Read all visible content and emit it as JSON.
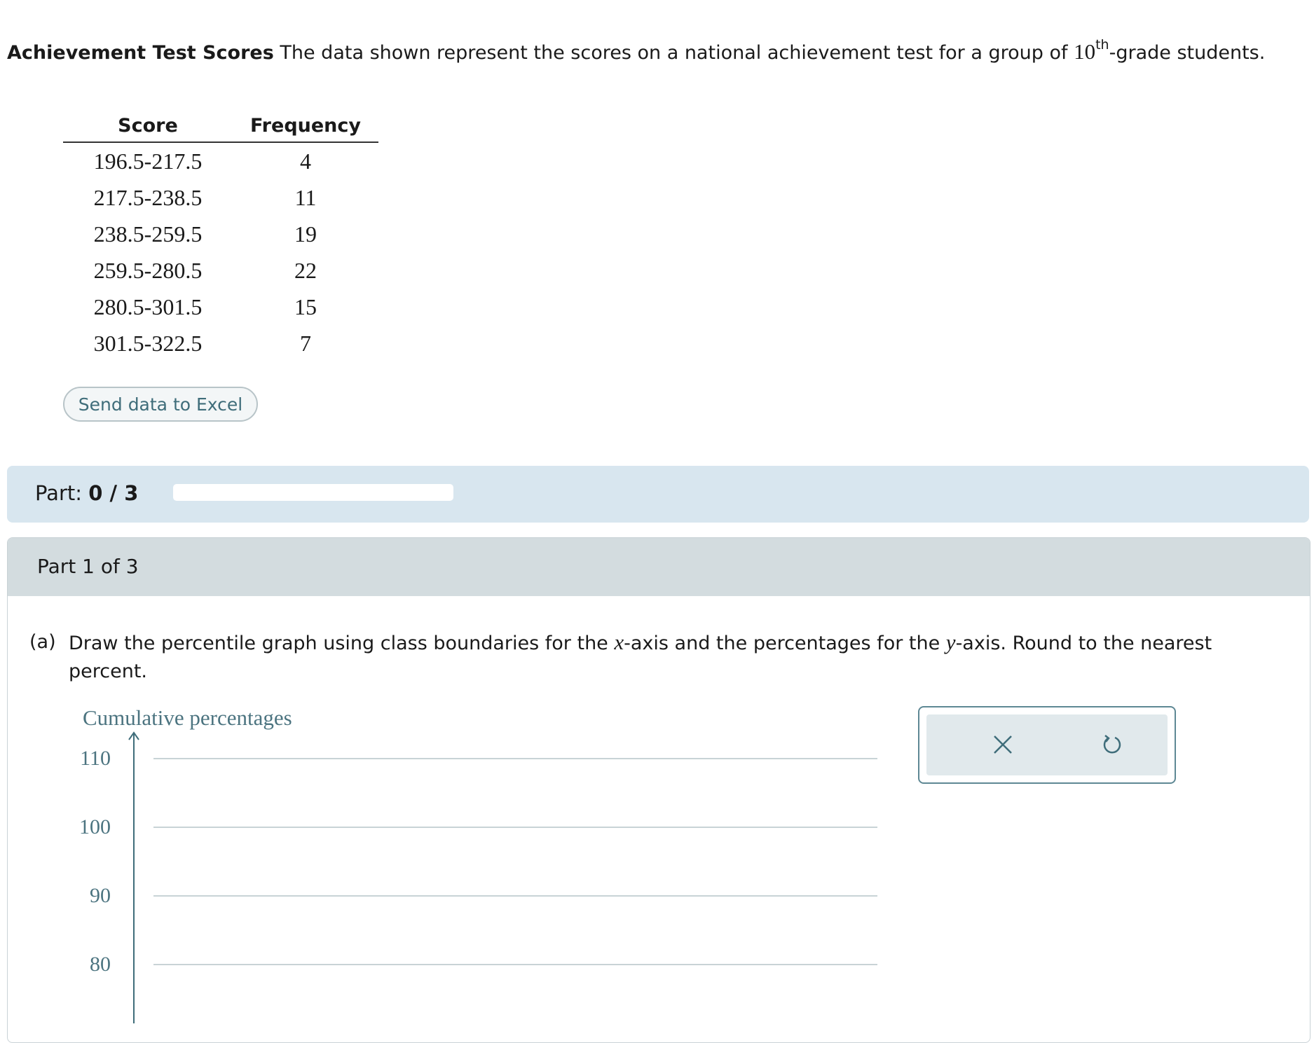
{
  "intro": {
    "title": "Achievement Test Scores",
    "text_before": " The data shown represent the scores on a national achievement test for a group of ",
    "grade_number": "10",
    "grade_suffix": "th",
    "text_after": "-grade students."
  },
  "table": {
    "headers": [
      "Score",
      "Frequency"
    ],
    "rows": [
      [
        "196.5-217.5",
        "4"
      ],
      [
        "217.5-238.5",
        "11"
      ],
      [
        "238.5-259.5",
        "19"
      ],
      [
        "259.5-280.5",
        "22"
      ],
      [
        "280.5-301.5",
        "15"
      ],
      [
        "301.5-322.5",
        "7"
      ]
    ]
  },
  "excel_button_label": "Send data to Excel",
  "part_progress": {
    "label": "Part: ",
    "value": "0 / 3",
    "fraction": 0
  },
  "part": {
    "heading": "Part 1 of 3",
    "question_tag": "(a)",
    "question_pre": "Draw the percentile graph using class boundaries for the ",
    "x_var": "x",
    "question_mid": "-axis and the percentages for the ",
    "y_var": "y",
    "question_post": "-axis. Round to the nearest percent."
  },
  "graph": {
    "y_axis_label": "Cumulative percentages",
    "y_ticks": [
      "110",
      "100",
      "90",
      "80"
    ],
    "colors": {
      "axis": "#3f6d7a",
      "label": "#4c7480",
      "grid": "#c8d3d6"
    }
  },
  "toolbox": {
    "icons": [
      "close-icon",
      "undo-icon"
    ],
    "accent": "#3f6d7a"
  }
}
